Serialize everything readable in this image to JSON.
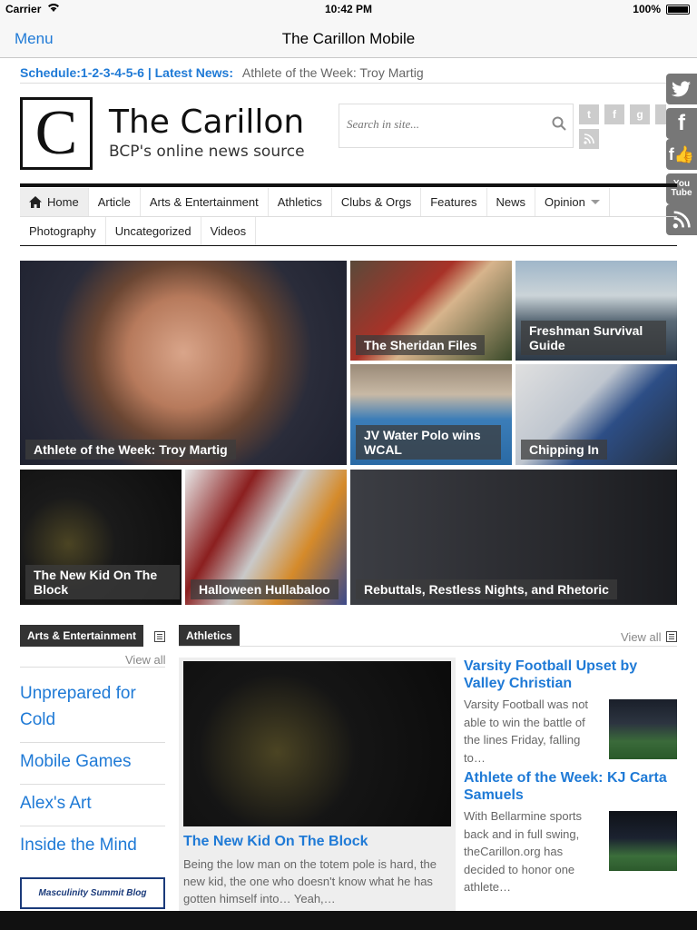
{
  "status_bar": {
    "carrier": "Carrier",
    "time": "10:42 PM",
    "battery": "100%"
  },
  "nav": {
    "menu_label": "Menu",
    "title": "The Carillon Mobile"
  },
  "ticker": {
    "schedule": "Schedule:1-2-3-4-5-6 | Latest News:",
    "item": "Athlete of the Week: Troy Martig"
  },
  "header": {
    "logo_letter": "C",
    "site_title": "The Carillon",
    "tagline": "BCP's online news source",
    "search_placeholder": "Search in site..."
  },
  "social_small": [
    "twitter-icon",
    "facebook-icon",
    "google-icon",
    "youtube-icon",
    "rss-icon"
  ],
  "social_float": [
    "twitter-icon",
    "facebook-icon",
    "facebook-like-icon",
    "youtube-icon",
    "rss-icon"
  ],
  "menu": {
    "row1": [
      "Home",
      "Article",
      "Arts & Entertainment",
      "Athletics",
      "Clubs & Orgs",
      "Features",
      "News",
      "Opinion"
    ],
    "row2": [
      "Photography",
      "Uncategorized",
      "Videos"
    ]
  },
  "featured": [
    "Athlete of the Week: Troy Martig",
    "The Sheridan Files",
    "Freshman Survival Guide",
    "JV Water Polo wins WCAL",
    "Chipping In",
    "The New Kid On The Block",
    "Halloween Hullabaloo",
    "Rebuttals, Restless Nights, and Rhetoric"
  ],
  "arts_entertainment": {
    "label": "Arts & Entertainment",
    "view_all": "View all",
    "items": [
      "Unprepared for Cold",
      "Mobile Games",
      "Alex's Art",
      "Inside the Mind"
    ],
    "banner": "Masculinity Summit Blog"
  },
  "athletics": {
    "label": "Athletics",
    "view_all": "View all",
    "main": {
      "title": "The New Kid On The Block",
      "excerpt": "Being the low man on the totem pole is hard, the new kid, the one who doesn't know what he has gotten himself into… Yeah,…"
    },
    "stories": [
      {
        "title": "Varsity Football Upset by Valley Christian",
        "excerpt": "Varsity Football was not able to win the battle of the lines Friday, falling to…"
      },
      {
        "title": "Athlete of the Week: KJ Carta Samuels",
        "excerpt": "With Bellarmine sports back and in full swing, theCarillon.org has decided to honor one athlete…"
      }
    ]
  },
  "colors": {
    "link": "#1f7ad6",
    "menu_rule": "#111111",
    "label_bg": "#333333"
  }
}
